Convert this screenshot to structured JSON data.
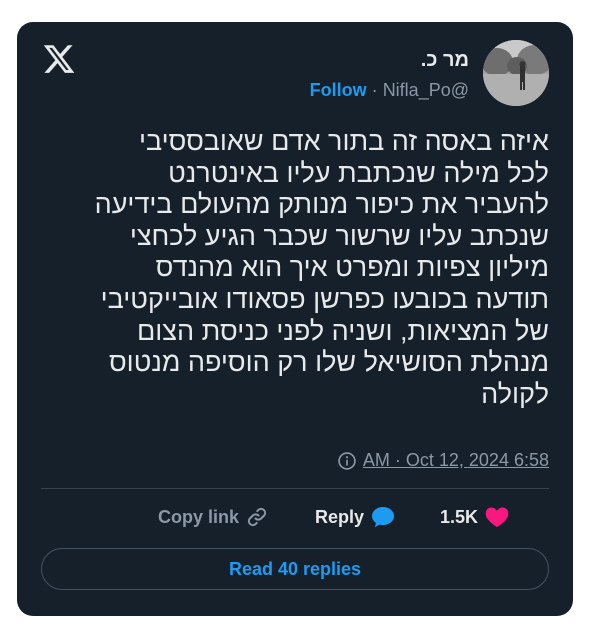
{
  "header": {
    "logo_icon": "x-logo-icon",
    "user_name": "מר כ.",
    "follow_label": "Follow",
    "separator": "·",
    "handle": "Nifla_Po@",
    "avatar_icon": "avatar"
  },
  "tweet": {
    "text": "איזה באסה זה בתור אדם שאובססיבי\nלכל מילה שנכתבת עליו באינטרנט\nלהעביר את כיפור מנותק מהעולם בידיעה\nשנכתב עליו שרשור שכבר הגיע לכחצי\nמיליון צפיות ומפרט איך הוא מהנדס\nתודעה בכובעו כפרשן פסאודו אובייקטיבי\nשל המציאות, ושניה לפני כניסת הצום\nמנהלת הסושיאל שלו רק הוסיפה מנטוס\nלקולה",
    "timestamp": "AM · Oct 12, 2024 6:58",
    "info_icon": "info-icon"
  },
  "actions": {
    "copy_link_label": "Copy link",
    "copy_link_icon": "link-icon",
    "reply_label": "Reply",
    "reply_icon": "speech-bubble-icon",
    "likes_count": "1.5K",
    "likes_icon": "heart-icon"
  },
  "footer": {
    "read_replies_label": "Read 40 replies"
  },
  "colors": {
    "card_bg": "#15202b",
    "accent": "#1d9bf0",
    "text": "#e7e9ea",
    "muted": "#8b98a5",
    "like": "#f91880"
  }
}
